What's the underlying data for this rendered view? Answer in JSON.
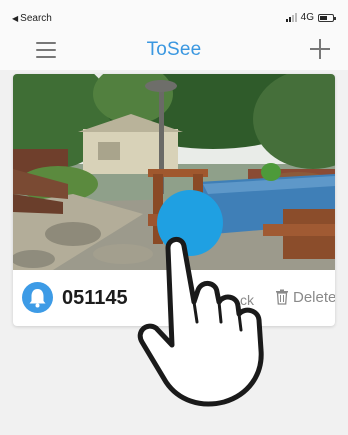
{
  "status_bar": {
    "back_label": "Search",
    "network": "4G"
  },
  "nav": {
    "title": "ToSee",
    "menu_icon": "hamburger-menu-icon",
    "add_icon": "plus-icon"
  },
  "device_card": {
    "preview_description_icon": "camera-preview",
    "device_icon": "bell-icon",
    "device_id": "051145",
    "lock_label": "ck",
    "delete_label": "Delete",
    "delete_icon": "trash-icon"
  },
  "colors": {
    "accent": "#3a97e0",
    "touch_indicator": "#1fa0e2",
    "background": "#f1f1f1"
  }
}
